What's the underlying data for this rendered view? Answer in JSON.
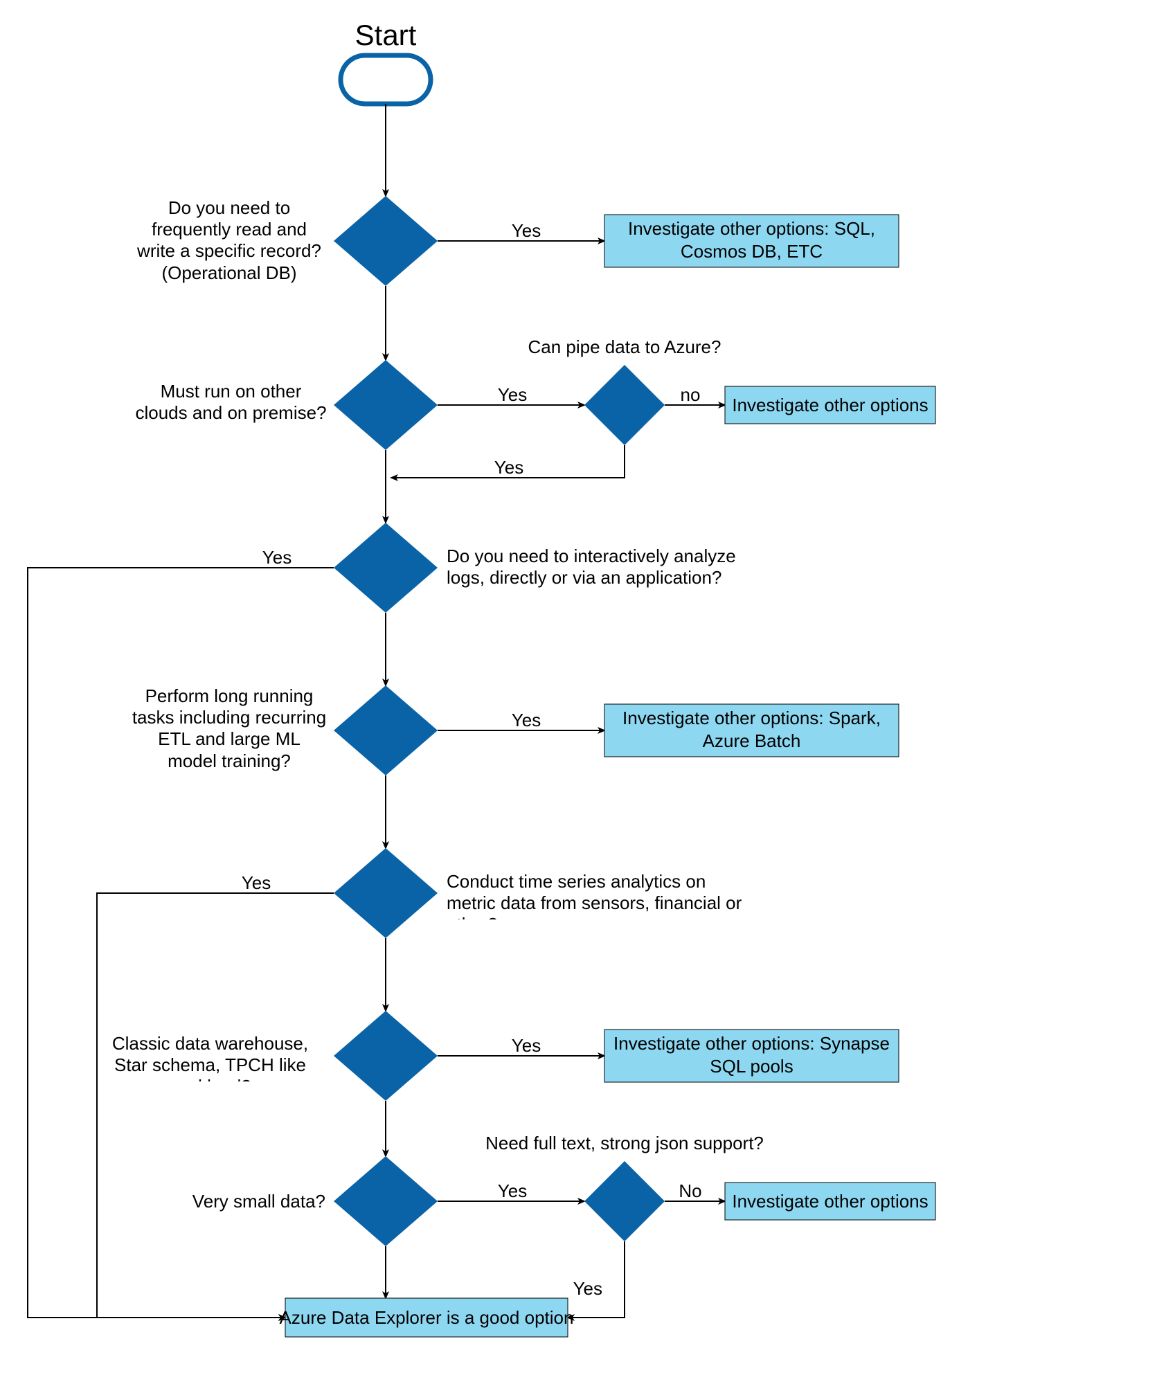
{
  "start": "Start",
  "decisions": {
    "d1_q": "Do you need to frequently read and write a specific record? (Operational DB)",
    "d2_q": "Must run on other clouds and on premise?",
    "d2b_q": "Can pipe data to Azure?",
    "d3_q": "Do you need to interactively analyze logs, directly or via an application?",
    "d4_q": "Perform long running tasks including recurring ETL and large ML model training?",
    "d5_q": "Conduct time series analytics on metric data from sensors, financial or other?",
    "d6_q": "Classic data warehouse, Star schema, TPCH like workload?",
    "d7_q": "Very small data?",
    "d7b_q": "Need full text, strong json support?"
  },
  "processes": {
    "p1": "Investigate other options: SQL, Cosmos DB, ETC",
    "p2": "Investigate other options",
    "p4": "Investigate other options: Spark, Azure Batch",
    "p6": "Investigate other options: Synapse SQL pools",
    "p7": "Investigate other options",
    "final": "Azure Data Explorer is a good option"
  },
  "labels": {
    "yes": "Yes",
    "no": "No",
    "nolc": "no"
  },
  "chart_data": {
    "type": "flowchart",
    "nodes": [
      {
        "id": "start",
        "type": "terminator",
        "label": "Start"
      },
      {
        "id": "d1",
        "type": "decision",
        "label": "Do you need to frequently read and write a specific record? (Operational DB)"
      },
      {
        "id": "p1",
        "type": "process",
        "label": "Investigate other options: SQL, Cosmos DB, ETC"
      },
      {
        "id": "d2",
        "type": "decision",
        "label": "Must run on other clouds and on premise?"
      },
      {
        "id": "d2b",
        "type": "decision",
        "label": "Can pipe data to Azure?"
      },
      {
        "id": "p2",
        "type": "process",
        "label": "Investigate other options"
      },
      {
        "id": "d3",
        "type": "decision",
        "label": "Do you need to interactively analyze logs, directly or via an application?"
      },
      {
        "id": "d4",
        "type": "decision",
        "label": "Perform long running tasks including recurring ETL and large ML model training?"
      },
      {
        "id": "p4",
        "type": "process",
        "label": "Investigate other options: Spark, Azure Batch"
      },
      {
        "id": "d5",
        "type": "decision",
        "label": "Conduct time series analytics on metric data from sensors, financial or other?"
      },
      {
        "id": "d6",
        "type": "decision",
        "label": "Classic data warehouse, Star schema, TPCH like workload?"
      },
      {
        "id": "p6",
        "type": "process",
        "label": "Investigate other options: Synapse SQL pools"
      },
      {
        "id": "d7",
        "type": "decision",
        "label": "Very small data?"
      },
      {
        "id": "d7b",
        "type": "decision",
        "label": "Need full text, strong json support?"
      },
      {
        "id": "p7",
        "type": "process",
        "label": "Investigate other options"
      },
      {
        "id": "final",
        "type": "process",
        "label": "Azure Data Explorer is a good option"
      }
    ],
    "edges": [
      {
        "from": "start",
        "to": "d1"
      },
      {
        "from": "d1",
        "to": "p1",
        "label": "Yes"
      },
      {
        "from": "d1",
        "to": "d2"
      },
      {
        "from": "d2",
        "to": "d2b",
        "label": "Yes"
      },
      {
        "from": "d2b",
        "to": "p2",
        "label": "no"
      },
      {
        "from": "d2b",
        "to": "d3",
        "label": "Yes",
        "route": "back-to-main"
      },
      {
        "from": "d2",
        "to": "d3"
      },
      {
        "from": "d3",
        "to": "final",
        "label": "Yes",
        "route": "left-long"
      },
      {
        "from": "d3",
        "to": "d4"
      },
      {
        "from": "d4",
        "to": "p4",
        "label": "Yes"
      },
      {
        "from": "d4",
        "to": "d5"
      },
      {
        "from": "d5",
        "to": "final",
        "label": "Yes",
        "route": "left-mid"
      },
      {
        "from": "d5",
        "to": "d6"
      },
      {
        "from": "d6",
        "to": "p6",
        "label": "Yes"
      },
      {
        "from": "d6",
        "to": "d7"
      },
      {
        "from": "d7",
        "to": "d7b",
        "label": "Yes"
      },
      {
        "from": "d7b",
        "to": "p7",
        "label": "No"
      },
      {
        "from": "d7b",
        "to": "final",
        "label": "Yes"
      },
      {
        "from": "d7",
        "to": "final"
      }
    ]
  }
}
